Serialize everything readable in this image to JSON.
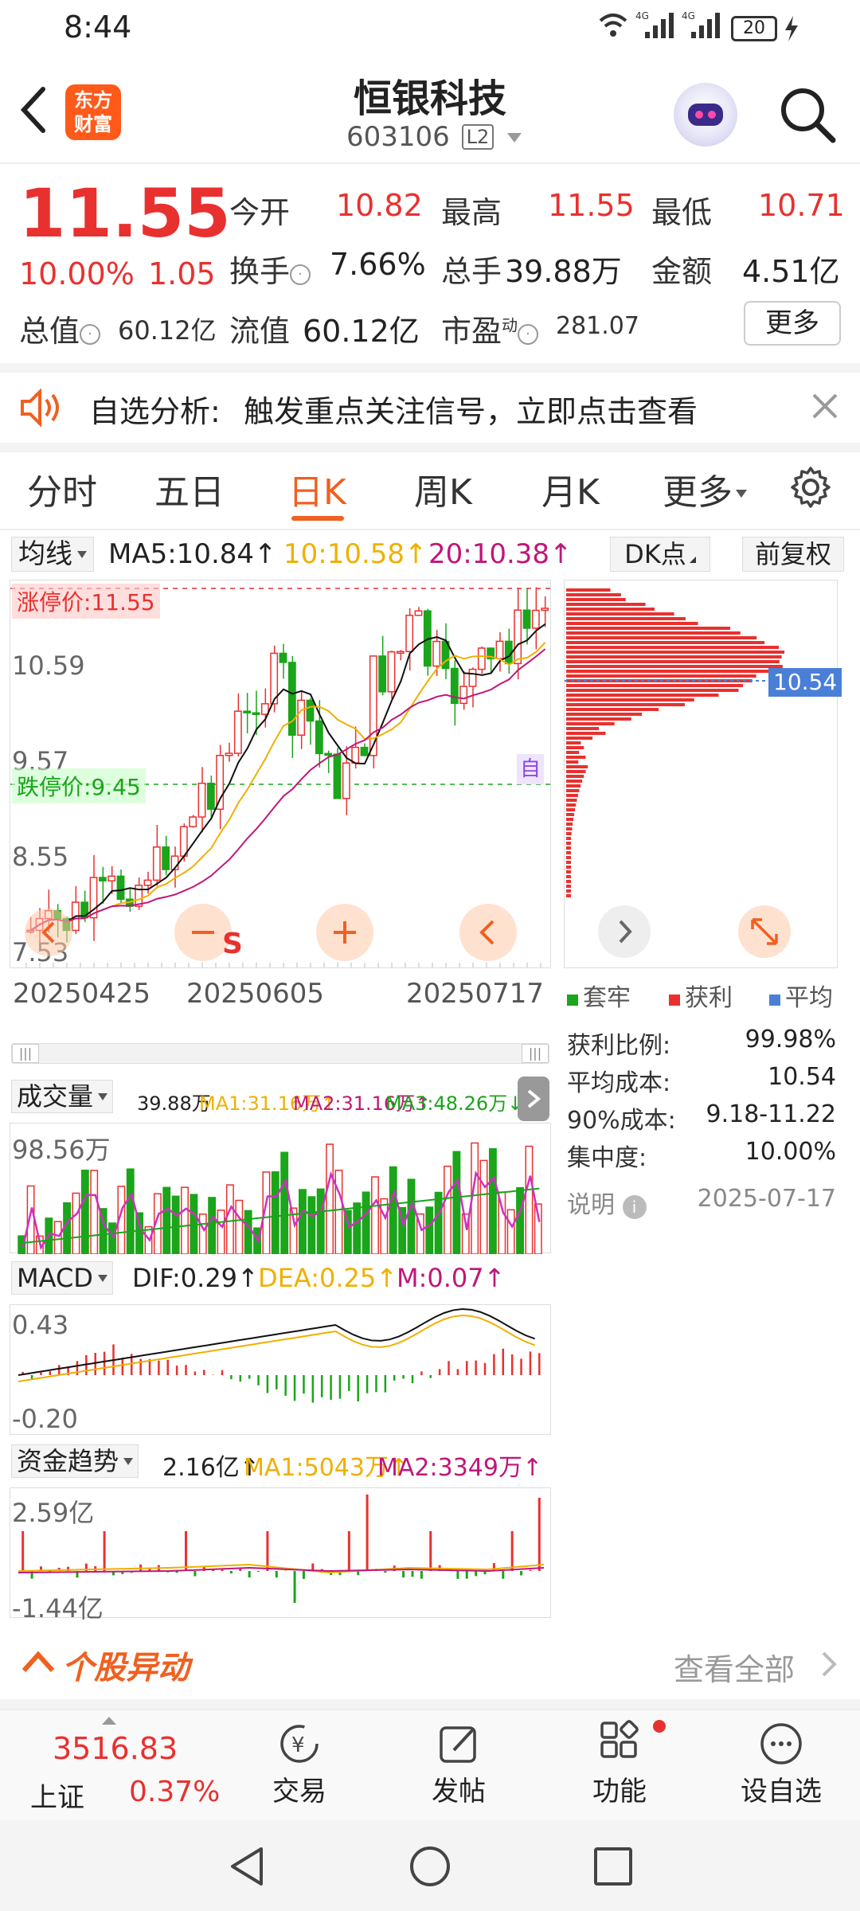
{
  "status_bar": {
    "time": "8:44",
    "battery": "20"
  },
  "header": {
    "title": "恒银科技",
    "code": "603106",
    "level": "L2",
    "brand_line1": "东方",
    "brand_line2": "财富"
  },
  "quote": {
    "price": "11.55",
    "change_pct": "10.00%",
    "change": "1.05",
    "open_label": "今开",
    "open": "10.82",
    "high_label": "最高",
    "high": "11.55",
    "low_label": "最低",
    "low": "10.71",
    "turnover_label": "换手",
    "turnover": "7.66%",
    "volume_label": "总手",
    "volume": "39.88万",
    "amount_label": "金额",
    "amount": "4.51亿",
    "mktcap_label": "总值",
    "mktcap": "60.12亿",
    "float_label": "流值",
    "float": "60.12亿",
    "pe_label": "市盈",
    "pe_sup": "动",
    "pe": "281.07",
    "more_button": "更多"
  },
  "banner": {
    "title": "自选分析:",
    "text": "触发重点关注信号，立即点击查看"
  },
  "tabs": [
    "分时",
    "五日",
    "日K",
    "周K",
    "月K",
    "更多"
  ],
  "active_tab": "日K",
  "kline": {
    "ma_selector": "均线",
    "ma5": "MA5:10.84↑",
    "ma10": "10:10.58↑",
    "ma20": "20:10.38↑",
    "dk_button": "DK点",
    "adjust_button": "前复权",
    "limit_up": "涨停价:11.55",
    "limit_down": "跌停价:9.45",
    "y_labels": [
      "10.59",
      "9.57",
      "8.55",
      "7.53"
    ],
    "dates": [
      "20250425",
      "20250605",
      "20250717"
    ],
    "auto_tag": "自",
    "s_marker": "S"
  },
  "chips": {
    "price_marker": "10.54",
    "legend": [
      "套牢",
      "获利",
      "平均"
    ],
    "rows": [
      {
        "label": "获利比例:",
        "value": "99.98%"
      },
      {
        "label": "平均成本:",
        "value": "10.54"
      },
      {
        "label": "90%成本:",
        "value": "9.18-11.22"
      },
      {
        "label": "集中度:",
        "value": "10.00%"
      }
    ],
    "note_label": "说明",
    "note_date": "2025-07-17"
  },
  "volume_panel": {
    "selector": "成交量",
    "vol": "39.88万",
    "ma1": "MA1:31.16万↑",
    "ma2": "MA2:31.16万↑",
    "ma3": "MA3:48.26万↓",
    "max_label": "98.56万"
  },
  "macd_panel": {
    "selector": "MACD",
    "dif": "DIF:0.29↑",
    "dea": "DEA:0.25↑",
    "m": "M:0.07↑",
    "top": "0.43",
    "bottom": "-0.20"
  },
  "fund_panel": {
    "selector": "资金趋势",
    "val": "2.16亿↑",
    "ma1": "MA1:5043万↑",
    "ma2": "MA2:3349万↑",
    "top": "2.59亿",
    "bottom": "-1.44亿"
  },
  "movement": {
    "title": "个股异动",
    "view_all": "查看全部"
  },
  "bottom_bar": {
    "index_value": "3516.83",
    "index_name": "上证",
    "index_change": "0.37%",
    "items": [
      "交易",
      "发帖",
      "功能",
      "设自选"
    ]
  },
  "colors": {
    "red": "#e8312f",
    "green": "#1aa51a",
    "orange": "#f06020",
    "ma10": "#f0b000",
    "ma20": "#c0167a"
  }
}
